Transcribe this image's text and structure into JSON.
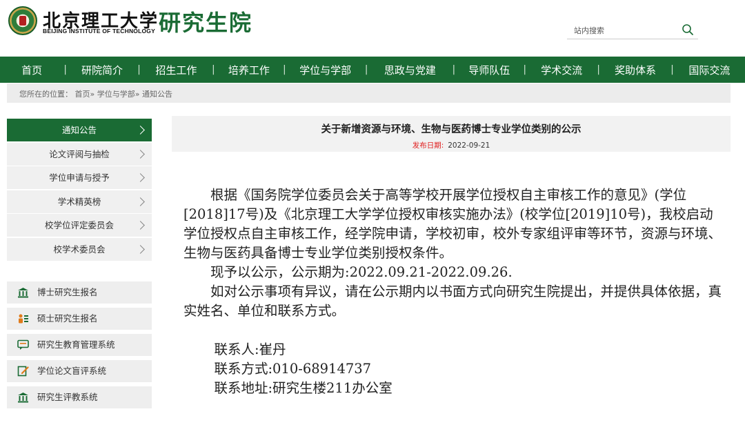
{
  "header": {
    "logo_cn": "北京理工大学",
    "logo_en": "BEIJING INSTITUTE OF TECHNOLOGY",
    "logo_sub": "研究生院",
    "search_placeholder": "站内搜索",
    "search_icon": "search-icon"
  },
  "nav": {
    "items": [
      "首页",
      "研院简介",
      "招生工作",
      "培养工作",
      "学位与学部",
      "思政与党建",
      "导师队伍",
      "学术交流",
      "奖助体系",
      "国际交流"
    ],
    "separator": "|"
  },
  "breadcrumb": {
    "prefix": "您所在的位置：",
    "path": "首页» 学位与学部» 通知公告"
  },
  "sidebar": {
    "items": [
      {
        "label": "通知公告",
        "active": true
      },
      {
        "label": "论文评阅与抽检"
      },
      {
        "label": "学位申请与授予"
      },
      {
        "label": "学术精英榜"
      },
      {
        "label": "校学位评定委员会"
      },
      {
        "label": "校学术委员会"
      }
    ]
  },
  "systems": {
    "items": [
      {
        "label": "博士研究生报名",
        "icon": "building-icon"
      },
      {
        "label": "硕士研究生报名",
        "icon": "people-icon"
      },
      {
        "label": "研究生教育管理系统",
        "icon": "chat-icon"
      },
      {
        "label": "学位论文盲评系统",
        "icon": "edit-icon"
      },
      {
        "label": "研究生评教系统",
        "icon": "building-icon"
      }
    ]
  },
  "article": {
    "title": "关于新增资源与环境、生物与医药博士专业学位类别的公示",
    "date_label": "发布日期:",
    "date": "2022-09-21",
    "para1": "根据《国务院学位委员会关于高等学校开展学位授权自主审核工作的意见》(学位[2018]17号)及《北京理工大学学位授权审核实施办法》(校学位[2019]10号)，我校启动学位授权点自主审核工作，经学院申请，学校初审，校外专家组评审等环节，资源与环境、生物与医药具备博士专业学位类别授权条件。",
    "para2": "现予以公示，公示期为:2022.09.21-2022.09.26.",
    "para3": "如对公示事项有异议，请在公示期内以书面方式向研究生院提出，并提供具体依据，真实姓名、单位和联系方式。",
    "contact_person": "联系人:崔丹",
    "contact_phone": "联系方式:010-68914737",
    "contact_address": "联系地址:研究生楼211办公室"
  },
  "colors": {
    "brand_green": "#1a6b34",
    "date_red": "#e02020",
    "panel_gray": "#f0f0f0"
  }
}
